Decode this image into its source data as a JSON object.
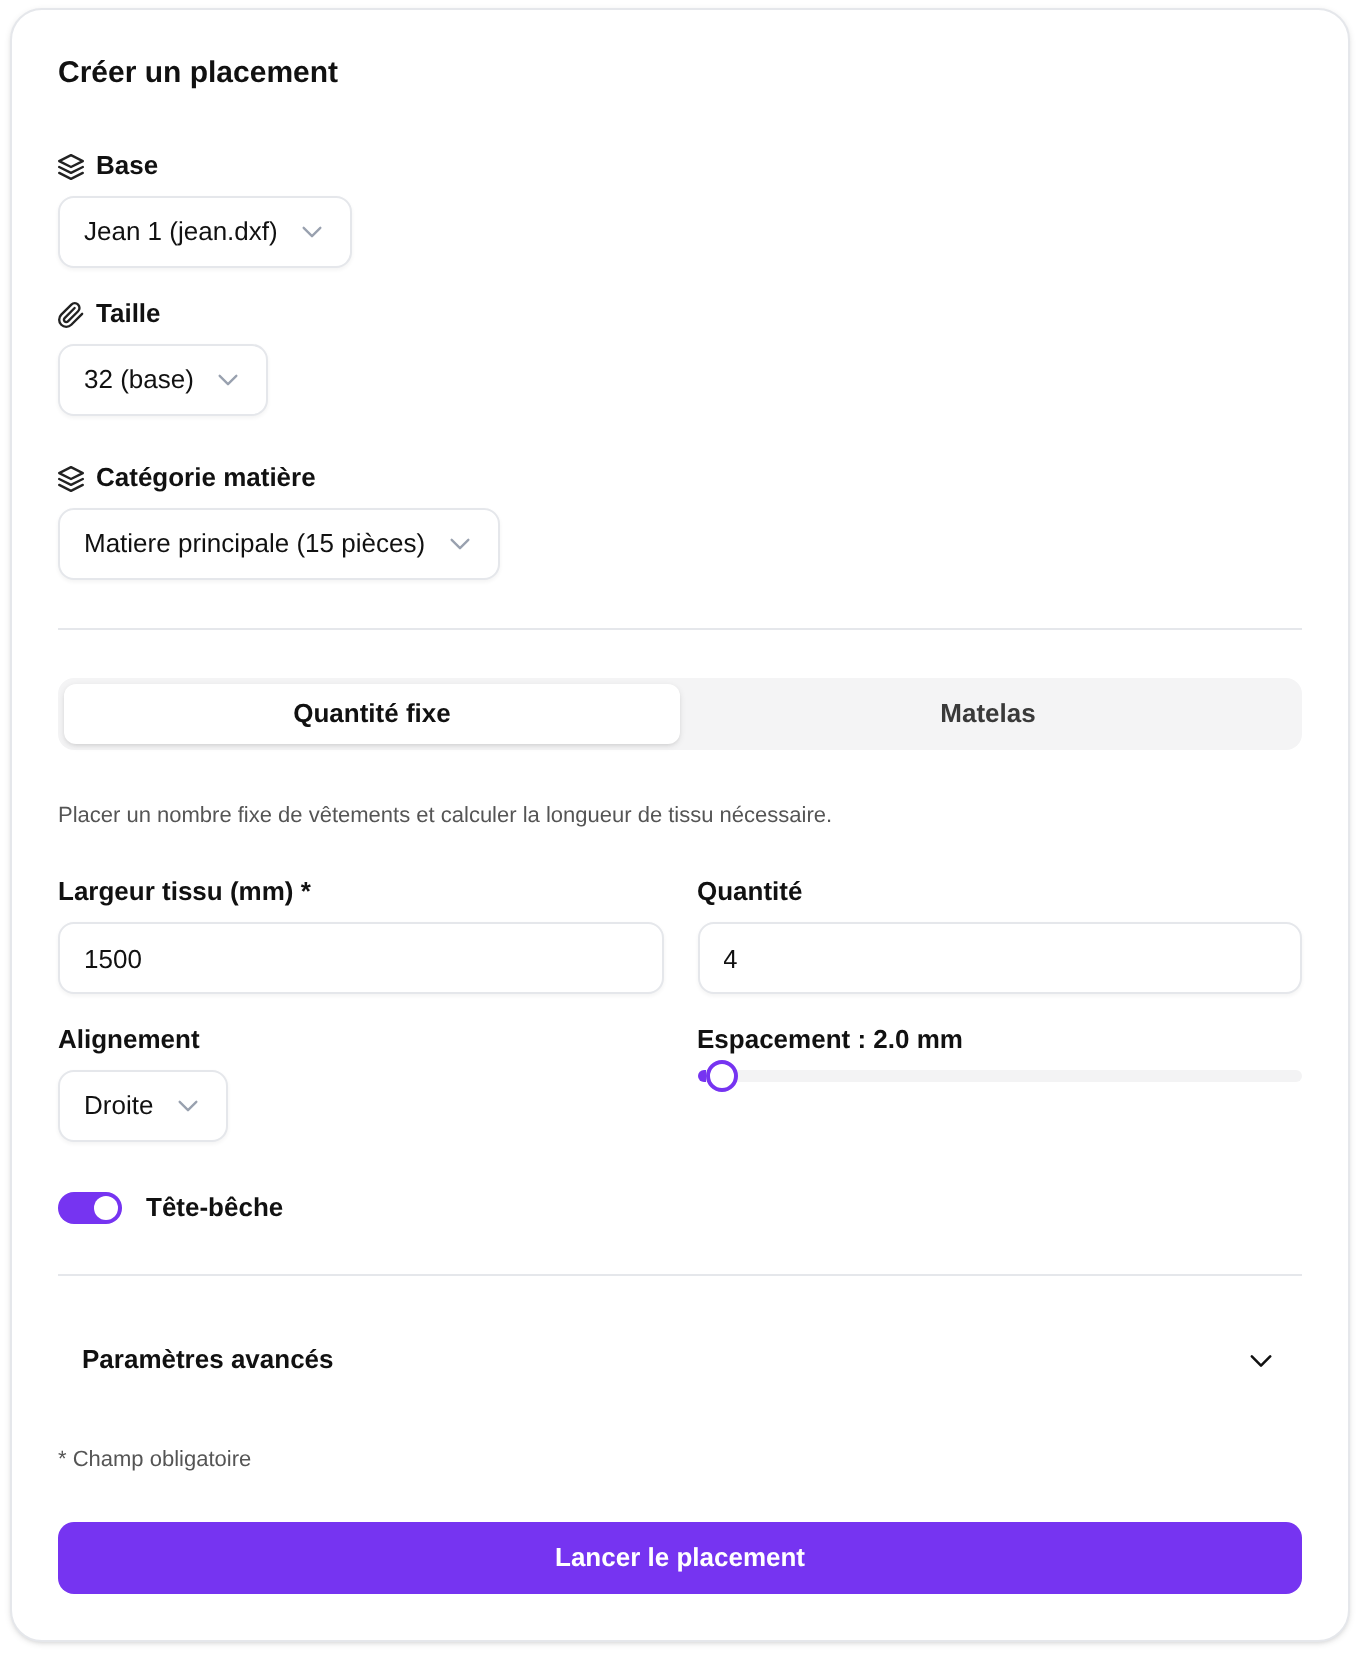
{
  "form": {
    "title": "Créer un placement"
  },
  "source_fields": [
    {
      "label": "Base",
      "value": "Jean 1 (jean.dxf)"
    },
    {
      "label": "Taille",
      "value": "32 (base)"
    },
    {
      "label": "Catégorie matière",
      "value": "Matiere principale (15 pièces)"
    }
  ],
  "mode_tabs": [
    {
      "label": "Quantité fixe",
      "selected": true
    },
    {
      "label": "Matelas",
      "selected": false
    }
  ],
  "mode_description": "Placer un nombre fixe de vêtements et calculer la longueur de tissu nécessaire.",
  "fabric_width": {
    "label": "Largeur tissu (mm) *",
    "value": "1500"
  },
  "quantity": {
    "label": "Quantité",
    "value": "4"
  },
  "alignment": {
    "label": "Alignement",
    "value": "Droite"
  },
  "spacing": {
    "label": "Espacement : 2.0 mm",
    "level": 0.04
  },
  "head_to_tail": {
    "label": "Tête-bêche",
    "on": true
  },
  "advanced": {
    "label": "Paramètres avancés",
    "expanded": false
  },
  "required_note": "* Champ obligatoire",
  "submit_button": "Lancer le placement"
}
